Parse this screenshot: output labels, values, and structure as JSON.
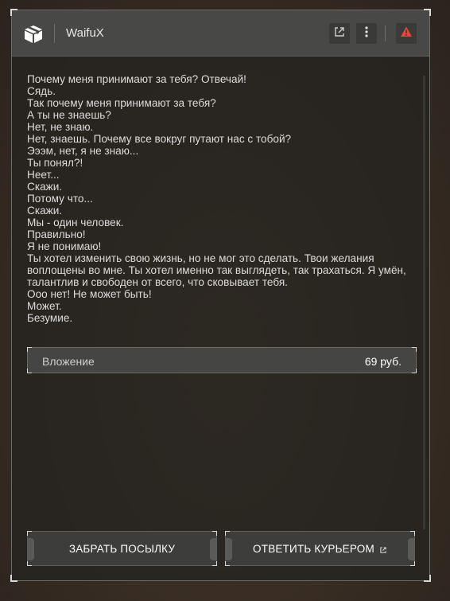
{
  "header": {
    "title": "WaifuX",
    "icons": [
      "package-icon",
      "external-link-icon",
      "more-vertical-icon",
      "warning-icon"
    ]
  },
  "message": {
    "lines": [
      "Почему меня принимают за тебя? Отвечай!",
      "Сядь.",
      "Так почему меня принимают за тебя?",
      "А ты не знаешь?",
      "Нет, не знаю.",
      "Нет, знаешь. Почему все вокруг путают нас с тобой?",
      "Эээм, нет, я не знаю...",
      "Ты понял?!",
      "Неет...",
      "Скажи.",
      "Потому что...",
      "Скажи.",
      "Мы - один человек.",
      "Правильно!",
      "Я не понимаю!",
      "Ты хотел изменить свою жизнь, но не мог это сделать. Твои желания воплощены во мне. Ты хотел именно так выглядеть, так трахаться. Я умён, талантлив и свободен от всего, что сковывает тебя.",
      "Ооо нет! Не может быть!",
      "Может.",
      "Безумие."
    ]
  },
  "attachment": {
    "label": "Вложение",
    "value": "69 руб."
  },
  "actions": {
    "pickup_label": "ЗАБРАТЬ ПОСЫЛКУ",
    "reply_label": "ОТВЕТИТЬ КУРЬЕРОМ"
  },
  "colors": {
    "warning": "#e0493b",
    "header_bg": "#484846",
    "panel_bg": "#262421"
  }
}
